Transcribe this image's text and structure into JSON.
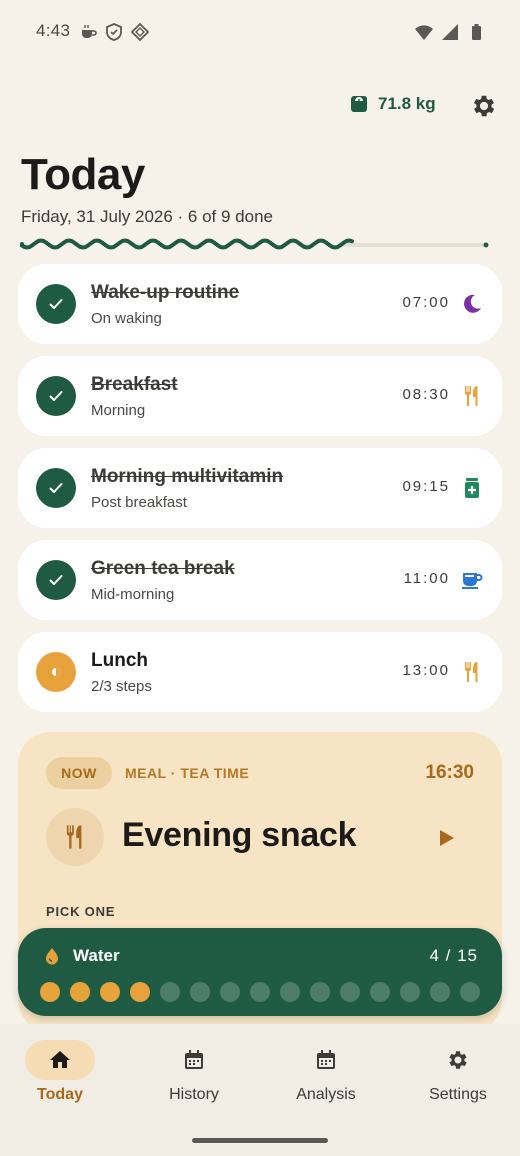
{
  "status_bar": {
    "time": "4:43"
  },
  "header": {
    "weight": "71.8 kg",
    "title": "Today",
    "subtitle": "Friday, 31 July 2026 · 6 of 9 done"
  },
  "progress": {
    "done": 6,
    "total": 9
  },
  "tasks": [
    {
      "title": "Wake-up routine",
      "sub": "On waking",
      "time": "07:00",
      "status": "done",
      "icon": "moon-icon",
      "icon_color": "#7b2fa8"
    },
    {
      "title": "Breakfast",
      "sub": "Morning",
      "time": "08:30",
      "status": "done",
      "icon": "fork-knife-icon",
      "icon_color": "#e8a23b"
    },
    {
      "title": "Morning multivitamin",
      "sub": "Post breakfast",
      "time": "09:15",
      "status": "done",
      "icon": "pill-bottle-icon",
      "icon_color": "#1f8a5e"
    },
    {
      "title": "Green tea break",
      "sub": "Mid-morning",
      "time": "11:00",
      "status": "done",
      "icon": "cup-icon",
      "icon_color": "#2a78d4"
    },
    {
      "title": "Lunch",
      "sub": "2/3 steps",
      "time": "13:00",
      "status": "partial",
      "icon": "fork-knife-icon",
      "icon_color": "#e8a23b"
    }
  ],
  "now_card": {
    "badge": "NOW",
    "category": "MEAL · TEA TIME",
    "time": "16:30",
    "title": "Evening snack",
    "pick_label": "PICK ONE",
    "icon": "fork-knife-icon"
  },
  "water": {
    "label": "Water",
    "count": "4  /  15",
    "filled": 4,
    "total": 15
  },
  "nav": [
    {
      "label": "Today",
      "icon": "home-icon",
      "active": true
    },
    {
      "label": "History",
      "icon": "calendar-icon",
      "active": false
    },
    {
      "label": "Analysis",
      "icon": "calendar-icon",
      "active": false
    },
    {
      "label": "Settings",
      "icon": "gear-icon",
      "active": false
    }
  ],
  "colors": {
    "primary": "#1f5a43",
    "accent": "#e8a23b",
    "background": "#f6f2ea",
    "now_card": "#f6e4c4"
  }
}
